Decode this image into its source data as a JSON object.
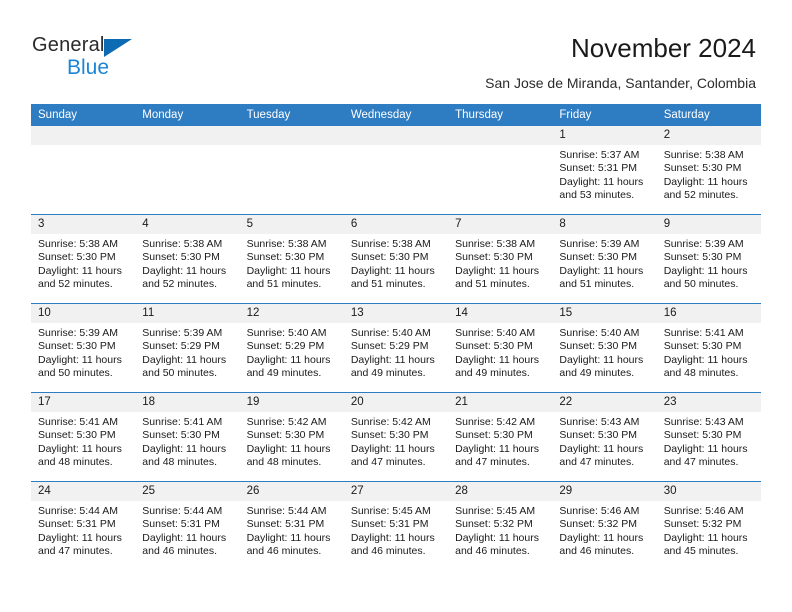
{
  "brand": {
    "name_part1": "General",
    "name_part2": "Blue",
    "triangle_icon": "blue-triangle-icon",
    "accent_color": "#1b86d6",
    "header_color": "#2e7cc2"
  },
  "header": {
    "title": "November 2024",
    "subtitle": "San Jose de Miranda, Santander, Colombia"
  },
  "calendar": {
    "weekdays": [
      "Sunday",
      "Monday",
      "Tuesday",
      "Wednesday",
      "Thursday",
      "Friday",
      "Saturday"
    ],
    "labels": {
      "sunrise": "Sunrise:",
      "sunset": "Sunset:",
      "daylight": "Daylight:"
    },
    "weeks": [
      [
        {
          "day": "",
          "blank": true
        },
        {
          "day": "",
          "blank": true
        },
        {
          "day": "",
          "blank": true
        },
        {
          "day": "",
          "blank": true
        },
        {
          "day": "",
          "blank": true
        },
        {
          "day": "1",
          "sunrise": "Sunrise: 5:37 AM",
          "sunset": "Sunset: 5:31 PM",
          "daylight": "Daylight: 11 hours and 53 minutes."
        },
        {
          "day": "2",
          "sunrise": "Sunrise: 5:38 AM",
          "sunset": "Sunset: 5:30 PM",
          "daylight": "Daylight: 11 hours and 52 minutes."
        }
      ],
      [
        {
          "day": "3",
          "sunrise": "Sunrise: 5:38 AM",
          "sunset": "Sunset: 5:30 PM",
          "daylight": "Daylight: 11 hours and 52 minutes."
        },
        {
          "day": "4",
          "sunrise": "Sunrise: 5:38 AM",
          "sunset": "Sunset: 5:30 PM",
          "daylight": "Daylight: 11 hours and 52 minutes."
        },
        {
          "day": "5",
          "sunrise": "Sunrise: 5:38 AM",
          "sunset": "Sunset: 5:30 PM",
          "daylight": "Daylight: 11 hours and 51 minutes."
        },
        {
          "day": "6",
          "sunrise": "Sunrise: 5:38 AM",
          "sunset": "Sunset: 5:30 PM",
          "daylight": "Daylight: 11 hours and 51 minutes."
        },
        {
          "day": "7",
          "sunrise": "Sunrise: 5:38 AM",
          "sunset": "Sunset: 5:30 PM",
          "daylight": "Daylight: 11 hours and 51 minutes."
        },
        {
          "day": "8",
          "sunrise": "Sunrise: 5:39 AM",
          "sunset": "Sunset: 5:30 PM",
          "daylight": "Daylight: 11 hours and 51 minutes."
        },
        {
          "day": "9",
          "sunrise": "Sunrise: 5:39 AM",
          "sunset": "Sunset: 5:30 PM",
          "daylight": "Daylight: 11 hours and 50 minutes."
        }
      ],
      [
        {
          "day": "10",
          "sunrise": "Sunrise: 5:39 AM",
          "sunset": "Sunset: 5:30 PM",
          "daylight": "Daylight: 11 hours and 50 minutes."
        },
        {
          "day": "11",
          "sunrise": "Sunrise: 5:39 AM",
          "sunset": "Sunset: 5:29 PM",
          "daylight": "Daylight: 11 hours and 50 minutes."
        },
        {
          "day": "12",
          "sunrise": "Sunrise: 5:40 AM",
          "sunset": "Sunset: 5:29 PM",
          "daylight": "Daylight: 11 hours and 49 minutes."
        },
        {
          "day": "13",
          "sunrise": "Sunrise: 5:40 AM",
          "sunset": "Sunset: 5:29 PM",
          "daylight": "Daylight: 11 hours and 49 minutes."
        },
        {
          "day": "14",
          "sunrise": "Sunrise: 5:40 AM",
          "sunset": "Sunset: 5:30 PM",
          "daylight": "Daylight: 11 hours and 49 minutes."
        },
        {
          "day": "15",
          "sunrise": "Sunrise: 5:40 AM",
          "sunset": "Sunset: 5:30 PM",
          "daylight": "Daylight: 11 hours and 49 minutes."
        },
        {
          "day": "16",
          "sunrise": "Sunrise: 5:41 AM",
          "sunset": "Sunset: 5:30 PM",
          "daylight": "Daylight: 11 hours and 48 minutes."
        }
      ],
      [
        {
          "day": "17",
          "sunrise": "Sunrise: 5:41 AM",
          "sunset": "Sunset: 5:30 PM",
          "daylight": "Daylight: 11 hours and 48 minutes."
        },
        {
          "day": "18",
          "sunrise": "Sunrise: 5:41 AM",
          "sunset": "Sunset: 5:30 PM",
          "daylight": "Daylight: 11 hours and 48 minutes."
        },
        {
          "day": "19",
          "sunrise": "Sunrise: 5:42 AM",
          "sunset": "Sunset: 5:30 PM",
          "daylight": "Daylight: 11 hours and 48 minutes."
        },
        {
          "day": "20",
          "sunrise": "Sunrise: 5:42 AM",
          "sunset": "Sunset: 5:30 PM",
          "daylight": "Daylight: 11 hours and 47 minutes."
        },
        {
          "day": "21",
          "sunrise": "Sunrise: 5:42 AM",
          "sunset": "Sunset: 5:30 PM",
          "daylight": "Daylight: 11 hours and 47 minutes."
        },
        {
          "day": "22",
          "sunrise": "Sunrise: 5:43 AM",
          "sunset": "Sunset: 5:30 PM",
          "daylight": "Daylight: 11 hours and 47 minutes."
        },
        {
          "day": "23",
          "sunrise": "Sunrise: 5:43 AM",
          "sunset": "Sunset: 5:30 PM",
          "daylight": "Daylight: 11 hours and 47 minutes."
        }
      ],
      [
        {
          "day": "24",
          "sunrise": "Sunrise: 5:44 AM",
          "sunset": "Sunset: 5:31 PM",
          "daylight": "Daylight: 11 hours and 47 minutes."
        },
        {
          "day": "25",
          "sunrise": "Sunrise: 5:44 AM",
          "sunset": "Sunset: 5:31 PM",
          "daylight": "Daylight: 11 hours and 46 minutes."
        },
        {
          "day": "26",
          "sunrise": "Sunrise: 5:44 AM",
          "sunset": "Sunset: 5:31 PM",
          "daylight": "Daylight: 11 hours and 46 minutes."
        },
        {
          "day": "27",
          "sunrise": "Sunrise: 5:45 AM",
          "sunset": "Sunset: 5:31 PM",
          "daylight": "Daylight: 11 hours and 46 minutes."
        },
        {
          "day": "28",
          "sunrise": "Sunrise: 5:45 AM",
          "sunset": "Sunset: 5:32 PM",
          "daylight": "Daylight: 11 hours and 46 minutes."
        },
        {
          "day": "29",
          "sunrise": "Sunrise: 5:46 AM",
          "sunset": "Sunset: 5:32 PM",
          "daylight": "Daylight: 11 hours and 46 minutes."
        },
        {
          "day": "30",
          "sunrise": "Sunrise: 5:46 AM",
          "sunset": "Sunset: 5:32 PM",
          "daylight": "Daylight: 11 hours and 45 minutes."
        }
      ]
    ]
  }
}
